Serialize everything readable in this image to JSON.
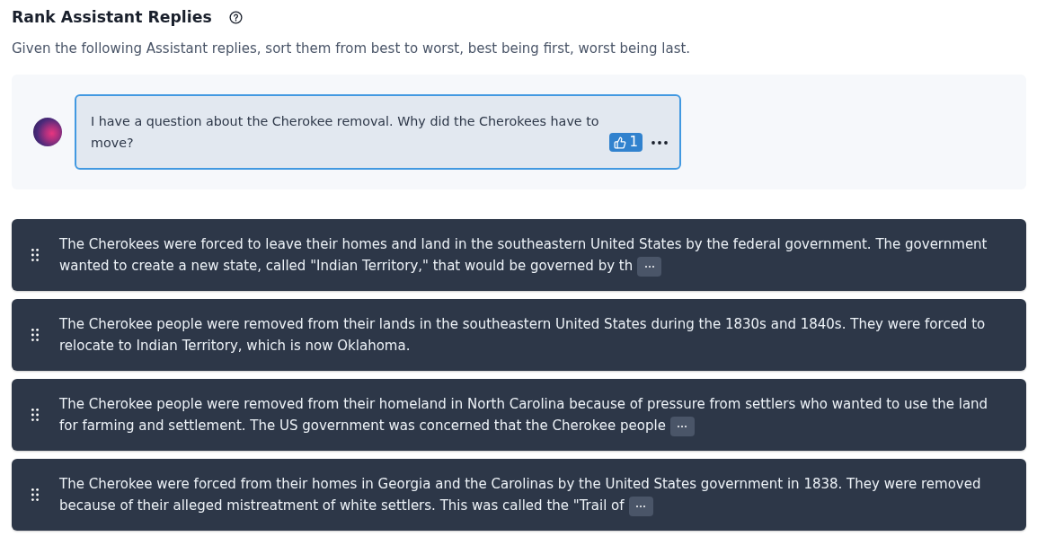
{
  "header": {
    "title": "Rank Assistant Replies",
    "instructions": "Given the following Assistant replies, sort them from best to worst, best being first, worst being last."
  },
  "prompt": {
    "text": "I have a question about the Cherokee removal. Why did the Cherokees have to move?",
    "likes": "1",
    "liked": true
  },
  "replies": [
    {
      "text": "The Cherokees were forced to leave their homes and land in the southeastern United States by the federal government. The government wanted to create a new state, called \"Indian Territory,\" that would be governed by th",
      "truncated": true
    },
    {
      "text": "The Cherokee people were removed from their lands in the southeastern United States during the 1830s and 1840s. They were forced to relocate to Indian Territory, which is now Oklahoma.",
      "truncated": false
    },
    {
      "text": "The Cherokee people were removed from their homeland in North Carolina because of pressure from settlers who wanted to use the land for farming and settlement. The US government was concerned that the Cherokee people",
      "truncated": true
    },
    {
      "text": "The Cherokee were forced from their homes in Georgia and the Carolinas by the United States government in 1838. They were removed because of their alleged mistreatment of white settlers. This was called the \"Trail of",
      "truncated": true
    }
  ]
}
